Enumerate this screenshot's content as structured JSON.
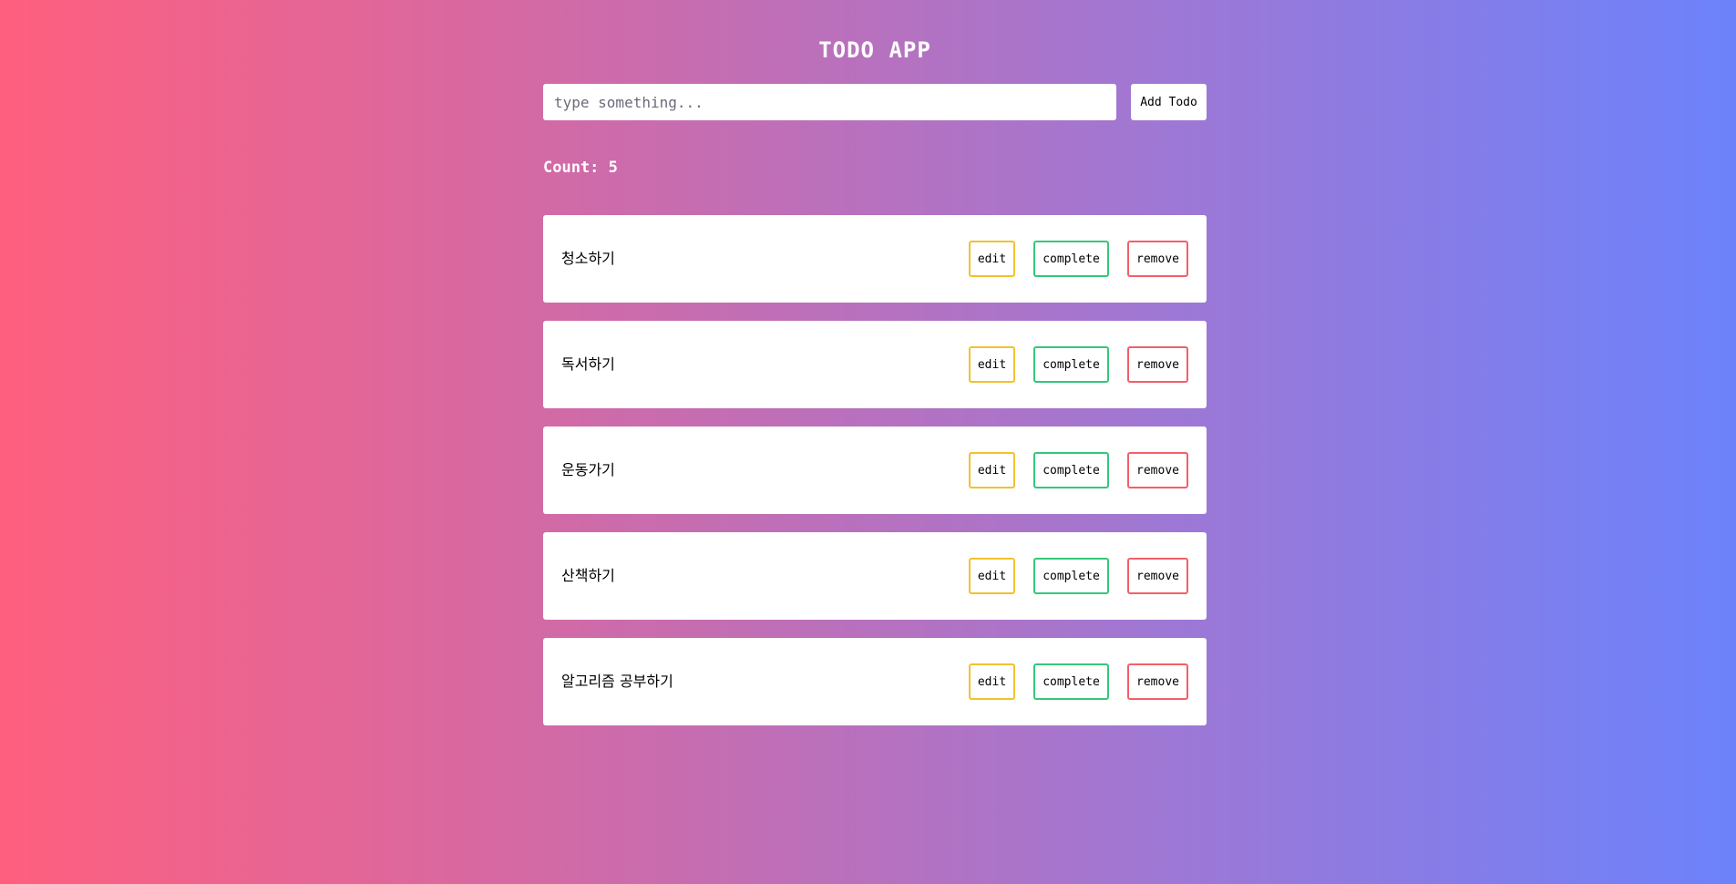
{
  "app": {
    "title": "TODO APP",
    "colors": {
      "background_start": "#ff5f7e",
      "background_end": "#6c82fb",
      "edit_border": "#f2c12e",
      "complete_border": "#34c77b",
      "remove_border": "#f25f6a"
    }
  },
  "input": {
    "value": "",
    "placeholder": "type something..."
  },
  "add_button": {
    "label": "Add Todo"
  },
  "count": {
    "text": "Count: 5"
  },
  "todos": [
    {
      "text": "청소하기",
      "edit_label": "edit",
      "complete_label": "complete",
      "remove_label": "remove"
    },
    {
      "text": "독서하기",
      "edit_label": "edit",
      "complete_label": "complete",
      "remove_label": "remove"
    },
    {
      "text": "운동가기",
      "edit_label": "edit",
      "complete_label": "complete",
      "remove_label": "remove"
    },
    {
      "text": "산책하기",
      "edit_label": "edit",
      "complete_label": "complete",
      "remove_label": "remove"
    },
    {
      "text": "알고리즘 공부하기",
      "edit_label": "edit",
      "complete_label": "complete",
      "remove_label": "remove"
    }
  ]
}
